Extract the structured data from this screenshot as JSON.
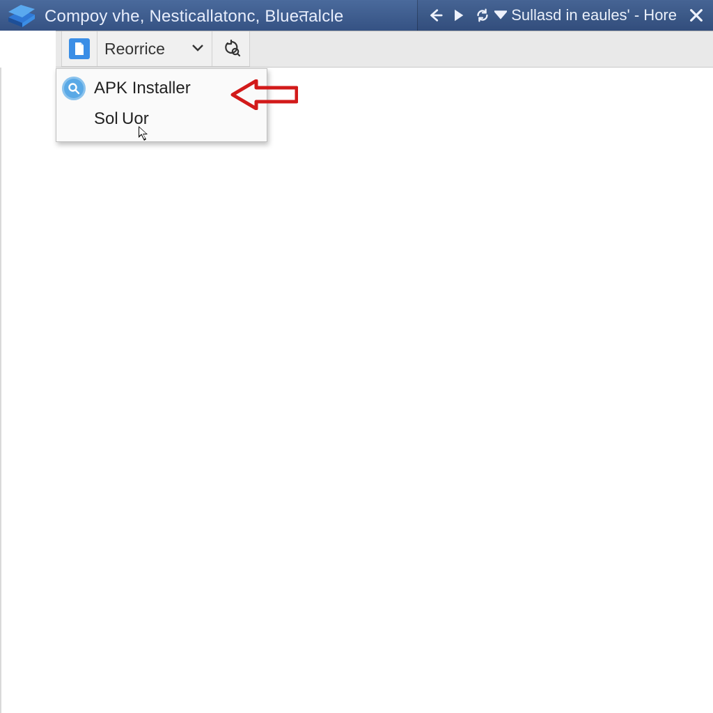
{
  "titlebar": {
    "title": "Compoy vhe, Nesticallatonc, Blueतalcle",
    "right_text": "Sullasd in eaules' - Hore"
  },
  "toolbar": {
    "dropdown_label": "Reorrice"
  },
  "dropdown": {
    "items": [
      {
        "label": "APK Installer",
        "icon": "search"
      },
      {
        "label": "Sol Uor",
        "icon": ""
      }
    ]
  }
}
